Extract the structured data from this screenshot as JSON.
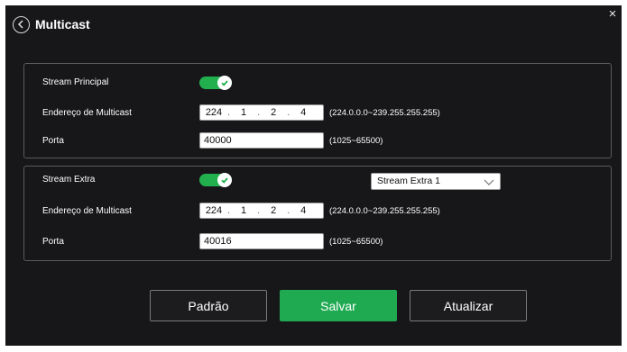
{
  "title": "Multicast",
  "colors": {
    "panel_bg": "#17171a",
    "accent": "#22b04f"
  },
  "icons": {
    "back": "back-chevron-circle-icon",
    "close": "close-icon",
    "check": "check-icon",
    "dropdown": "chevron-down-icon"
  },
  "stream_principal": {
    "label": "Stream Principal",
    "enabled": true,
    "multicast_label": "Endereço de Multicast",
    "ip": [
      "224",
      "1",
      "2",
      "4"
    ],
    "ip_range": "(224.0.0.0~239.255.255.255)",
    "port_label": "Porta",
    "port": "40000",
    "port_range": "(1025~65500)"
  },
  "stream_extra": {
    "label": "Stream Extra",
    "enabled": true,
    "select_value": "Stream Extra 1",
    "multicast_label": "Endereço de Multicast",
    "ip": [
      "224",
      "1",
      "2",
      "4"
    ],
    "ip_range": "(224.0.0.0~239.255.255.255)",
    "port_label": "Porta",
    "port": "40016",
    "port_range": "(1025~65500)"
  },
  "buttons": {
    "default": "Padrão",
    "save": "Salvar",
    "refresh": "Atualizar"
  },
  "close_glyph": "×"
}
